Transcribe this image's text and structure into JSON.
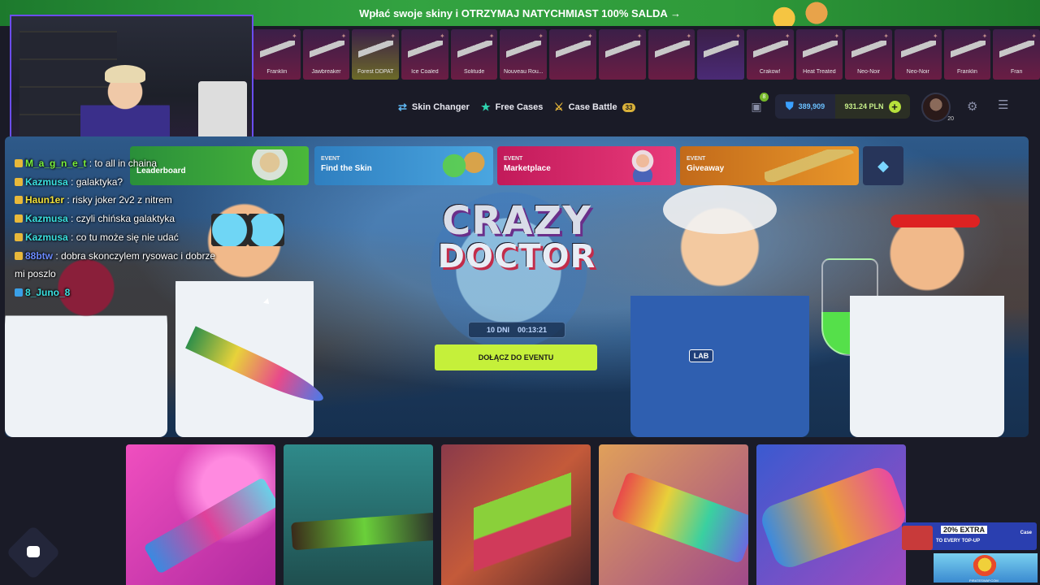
{
  "promo_banner": {
    "text_before": "Wpłać swoje skiny i ",
    "text_highlight": "OTRZYMAJ NATYCHMIAST 100% SALDA",
    "arrow": "→"
  },
  "live_drops": [
    {
      "name": "Franklin",
      "rarity_color": "#6a1d44"
    },
    {
      "name": "Jawbreaker",
      "rarity_color": "#6a1d44"
    },
    {
      "name": "Forest DDPAT",
      "rarity_color": "#6c6a28"
    },
    {
      "name": "Ice Coaled",
      "rarity_color": "#6a1d44"
    },
    {
      "name": "Solitude",
      "rarity_color": "#6a1d44"
    },
    {
      "name": "Nouveau Rou...",
      "rarity_color": "#6a1d44"
    },
    {
      "name": "",
      "rarity_color": "#6a1d44"
    },
    {
      "name": "",
      "rarity_color": "#6a1d44"
    },
    {
      "name": "",
      "rarity_color": "#6a1d44"
    },
    {
      "name": "",
      "rarity_color": "#4a2a75"
    },
    {
      "name": "Crakow!",
      "rarity_color": "#6a1d44"
    },
    {
      "name": "Heat Treated",
      "rarity_color": "#6a1d44"
    },
    {
      "name": "Neo-Noir",
      "rarity_color": "#6a1d44"
    },
    {
      "name": "Neo-Noir",
      "rarity_color": "#6a1d44"
    },
    {
      "name": "Franklin",
      "rarity_color": "#6a1d44"
    },
    {
      "name": "Fran",
      "rarity_color": "#6a1d44"
    }
  ],
  "nav": {
    "skin_changer": "Skin Changer",
    "free_cases": "Free Cases",
    "case_battle": "Case Battle",
    "case_battle_count": "33",
    "gift_count": "8",
    "coins": "389,909",
    "balance": "931.24 PLN",
    "avatar_level": "20"
  },
  "events": {
    "leaderboard": {
      "label": "Leaderboard"
    },
    "find_skin": {
      "tag": "EVENT",
      "label": "Find the Skin"
    },
    "marketplace": {
      "tag": "EVENT",
      "label": "Marketplace"
    },
    "giveaway": {
      "tag": "EVENT",
      "label": "Giveaway"
    }
  },
  "hero": {
    "title_line1": "CRAZY",
    "title_line2": "DOCTOR",
    "timer_days": "10 DNI",
    "timer_clock": "00:13:21",
    "join_button": "DOŁĄCZ DO EVENTU",
    "lab_badge": "LAB"
  },
  "chat": [
    {
      "user": "M_a_g_n_e_t",
      "message": "to all in chaina",
      "color": "#7af03a"
    },
    {
      "user": "Kazmusa",
      "message": "galaktyka?",
      "color": "#3ae0e0"
    },
    {
      "user": "Haun1er",
      "message": "risky joker 2v2 z nitrem",
      "color": "#f0e03a"
    },
    {
      "user": "Kazmusa",
      "message": "czyli chińska galaktyka",
      "color": "#3ae0e0"
    },
    {
      "user": "Kazmusa",
      "message": "co tu może się nie udać",
      "color": "#3ae0e0"
    },
    {
      "user": "88btw",
      "message": "dobra skonczylem rysowac i dobrze",
      "color": "#6a8aff"
    },
    {
      "user": "",
      "message": "mi poszlo",
      "color": "#ffffff"
    },
    {
      "user": "8_Juno_8",
      "message": "",
      "color": "#3ae0e0"
    }
  ],
  "promo_card": {
    "headline": "20% EXTRA",
    "sub": "TO EVERY TOP-UP",
    "brand": "Case"
  },
  "ad": {
    "url": "PIRATESWAP.COM"
  },
  "colors": {
    "accent_green": "#c5f03a",
    "nav_bg": "#1a1b27",
    "purple_border": "#6b4df0"
  }
}
